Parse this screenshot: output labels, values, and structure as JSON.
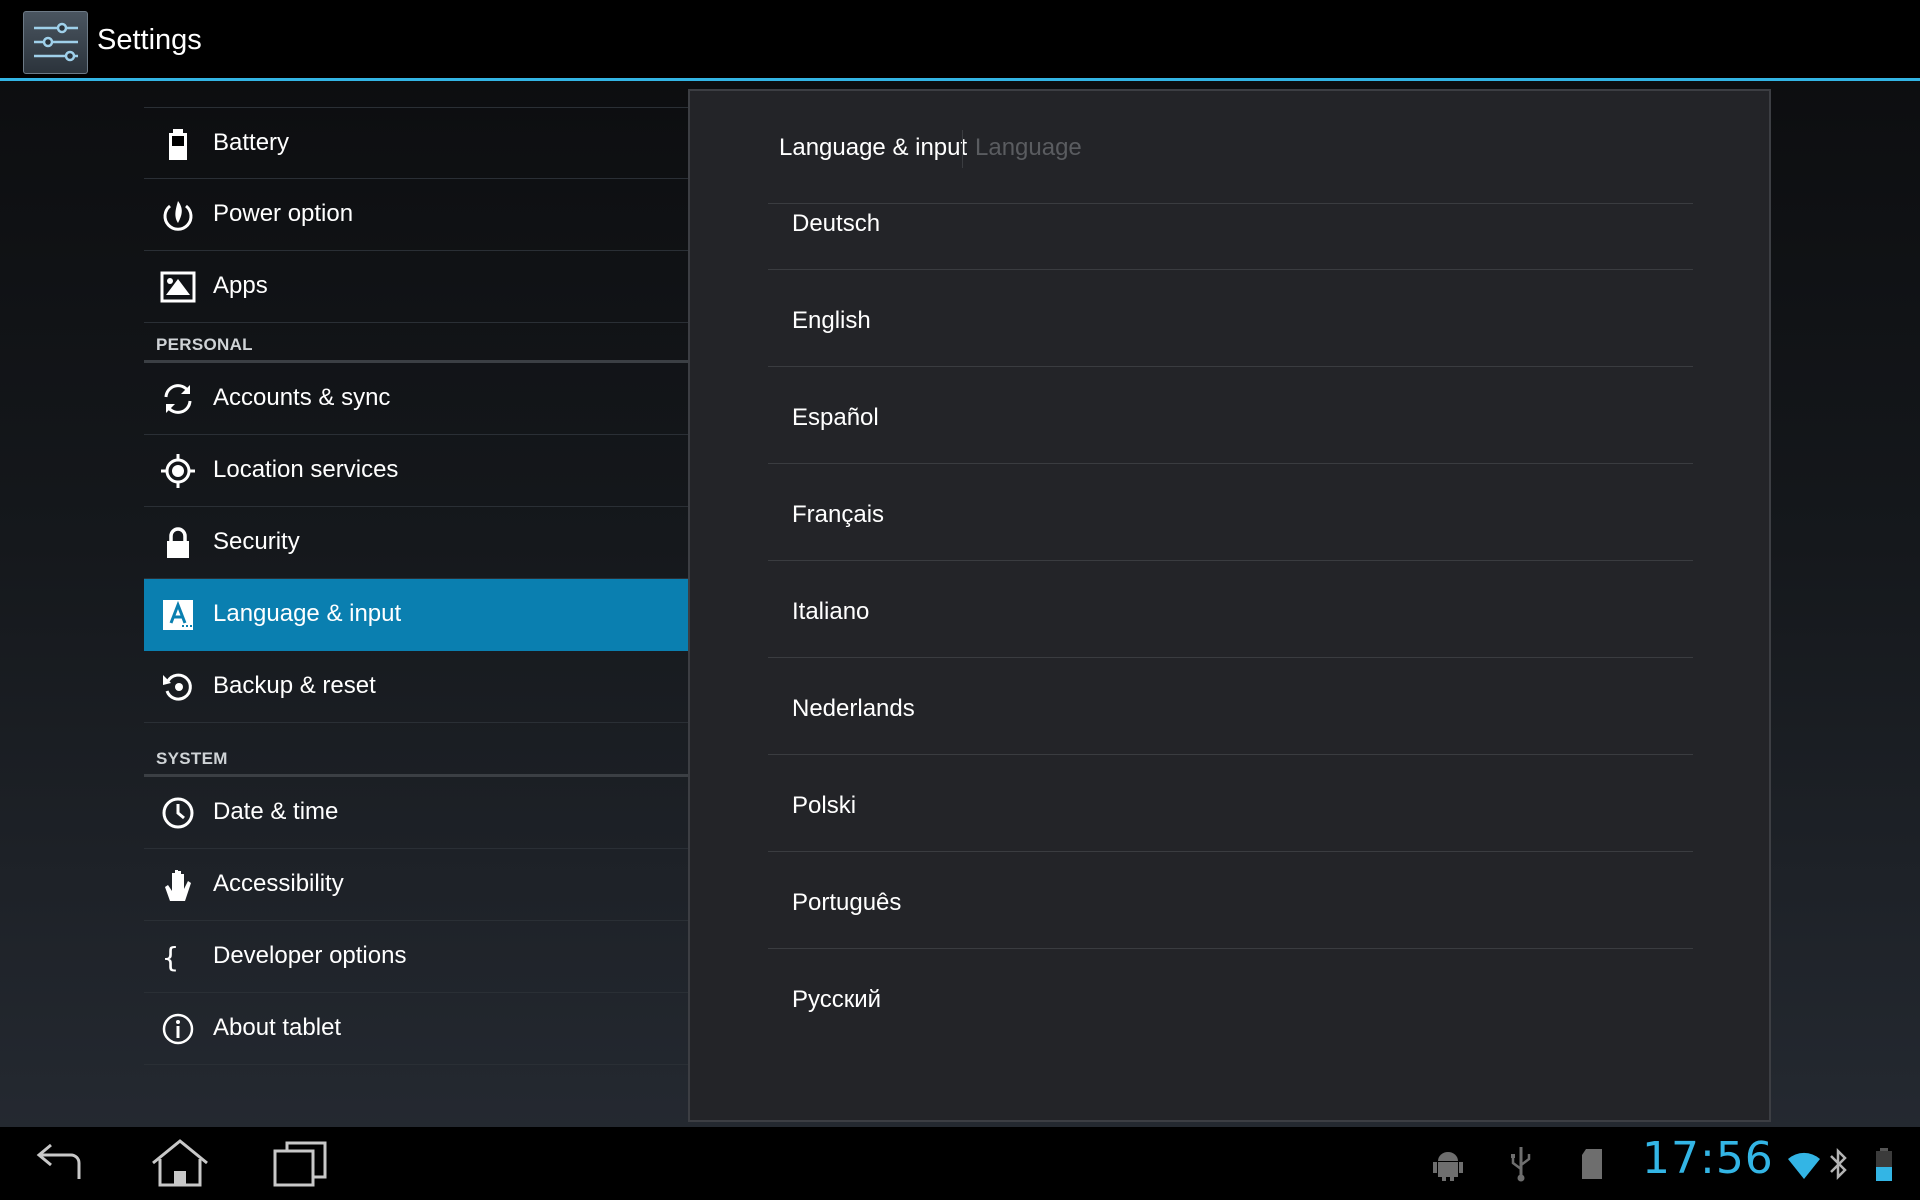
{
  "app": {
    "title": "Settings",
    "icon": "settings-sliders-icon"
  },
  "sidebar": {
    "items": [
      {
        "label": "Battery",
        "icon": "battery-icon"
      },
      {
        "label": "Power option",
        "icon": "flame-power-icon"
      },
      {
        "label": "Apps",
        "icon": "apps-icon"
      },
      {
        "section": "PERSONAL"
      },
      {
        "label": "Accounts & sync",
        "icon": "sync-icon"
      },
      {
        "label": "Location services",
        "icon": "location-icon"
      },
      {
        "label": "Security",
        "icon": "lock-icon"
      },
      {
        "label": "Language & input",
        "icon": "language-icon",
        "selected": true
      },
      {
        "label": "Backup & reset",
        "icon": "backup-icon"
      },
      {
        "section": "SYSTEM"
      },
      {
        "label": "Date & time",
        "icon": "clock-icon"
      },
      {
        "label": "Accessibility",
        "icon": "hand-icon"
      },
      {
        "label": "Developer options",
        "icon": "braces-icon"
      },
      {
        "label": "About tablet",
        "icon": "info-icon"
      }
    ]
  },
  "panel": {
    "breadcrumb": {
      "current": "Language & input",
      "child": "Language"
    },
    "languages": [
      "Deutsch",
      "English",
      "Español",
      "Français",
      "Italiano",
      "Nederlands",
      "Polski",
      "Português",
      "Русский"
    ]
  },
  "navbar": {
    "buttons": [
      "back-icon",
      "home-icon",
      "recent-apps-icon"
    ],
    "status_icons": [
      "android-debug-icon",
      "usb-icon",
      "sd-card-icon",
      "wifi-icon",
      "bluetooth-icon",
      "battery-status-icon"
    ],
    "clock": "17:56"
  },
  "colors": {
    "accent": "#33b5e5",
    "selected": "#0a7fb0"
  }
}
